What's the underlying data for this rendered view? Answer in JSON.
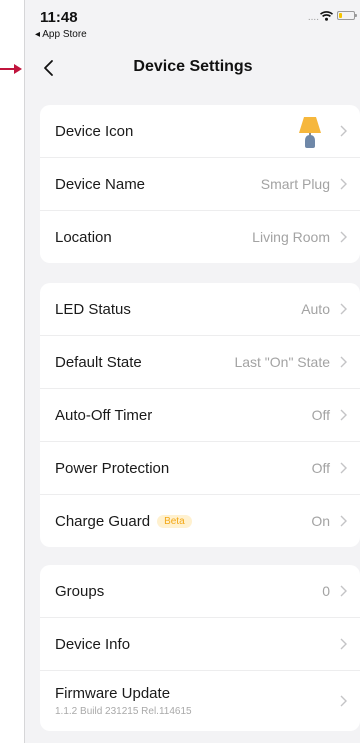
{
  "status": {
    "time": "11:48",
    "back_app": "◂ App Store",
    "signal": "....",
    "battery_color": "#f5c400"
  },
  "nav": {
    "title": "Device Settings",
    "back_icon": "chevron-left-icon"
  },
  "annotation": {
    "arrow_color": "#c0143c"
  },
  "groups": [
    {
      "rows": [
        {
          "label": "Device Icon",
          "value": "",
          "icon": "lamp-icon"
        },
        {
          "label": "Device Name",
          "value": "Smart Plug"
        },
        {
          "label": "Location",
          "value": "Living Room"
        }
      ]
    },
    {
      "rows": [
        {
          "label": "LED Status",
          "value": "Auto"
        },
        {
          "label": "Default State",
          "value": "Last \"On\" State"
        },
        {
          "label": "Auto-Off Timer",
          "value": "Off"
        },
        {
          "label": "Power Protection",
          "value": "Off"
        },
        {
          "label": "Charge Guard",
          "badge": "Beta",
          "value": "On"
        }
      ]
    },
    {
      "rows": [
        {
          "label": "Groups",
          "value": "0"
        },
        {
          "label": "Device Info",
          "value": ""
        },
        {
          "label": "Firmware Update",
          "sublabel": "1.1.2 Build 231215 Rel.114615",
          "value": ""
        }
      ]
    }
  ],
  "colors": {
    "badge_bg": "#fff1cf",
    "badge_text": "#f3a817",
    "lamp_shade": "#f6b73c",
    "lamp_base": "#6f88a8"
  }
}
